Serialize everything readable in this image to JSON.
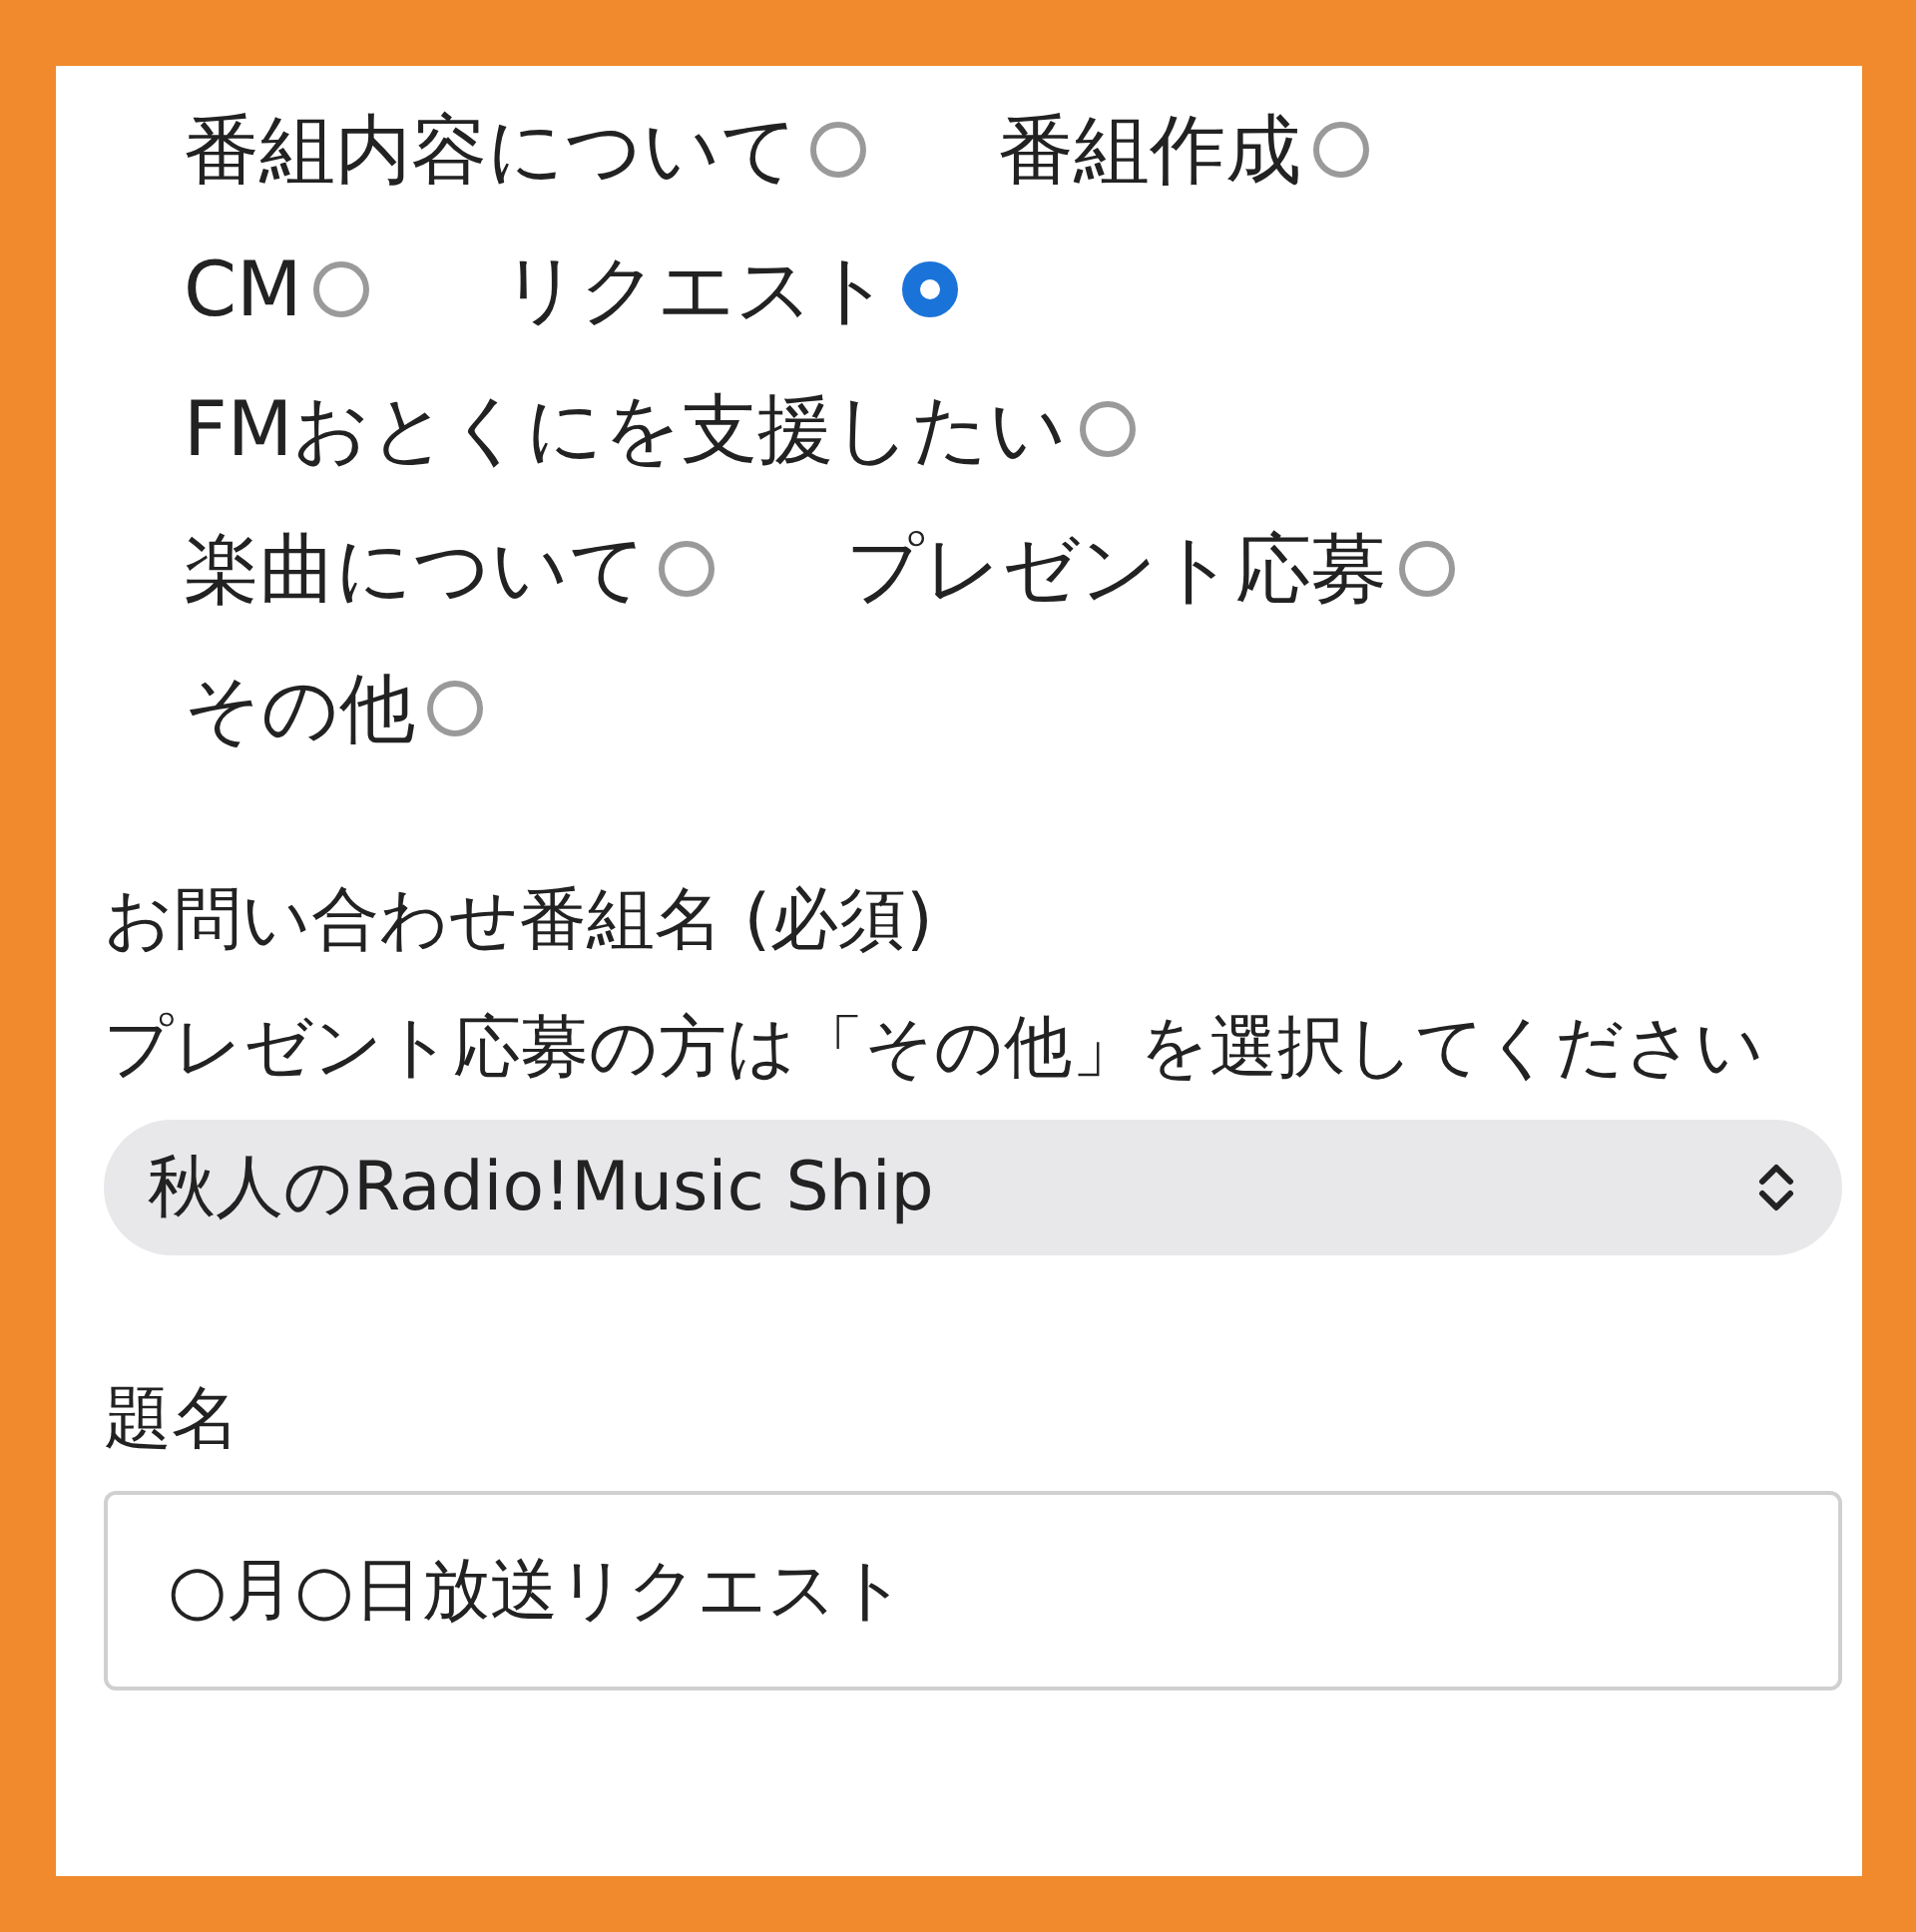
{
  "inquiry_type": {
    "options": [
      {
        "label": "番組内容について",
        "selected": false
      },
      {
        "label": "番組作成",
        "selected": false
      },
      {
        "label": "CM",
        "selected": false
      },
      {
        "label": "リクエスト",
        "selected": true
      },
      {
        "label": "FMおとくにを支援したい",
        "selected": false
      },
      {
        "label": "楽曲について",
        "selected": false
      },
      {
        "label": "プレゼント応募",
        "selected": false
      },
      {
        "label": "その他",
        "selected": false
      }
    ]
  },
  "program": {
    "label": "お問い合わせ番組名 (必須)",
    "note": "プレゼント応募の方は「その他」を選択してください",
    "value": "秋人のRadio!Music Ship"
  },
  "subject": {
    "label": "題名",
    "value": "○月○日放送リクエスト"
  }
}
